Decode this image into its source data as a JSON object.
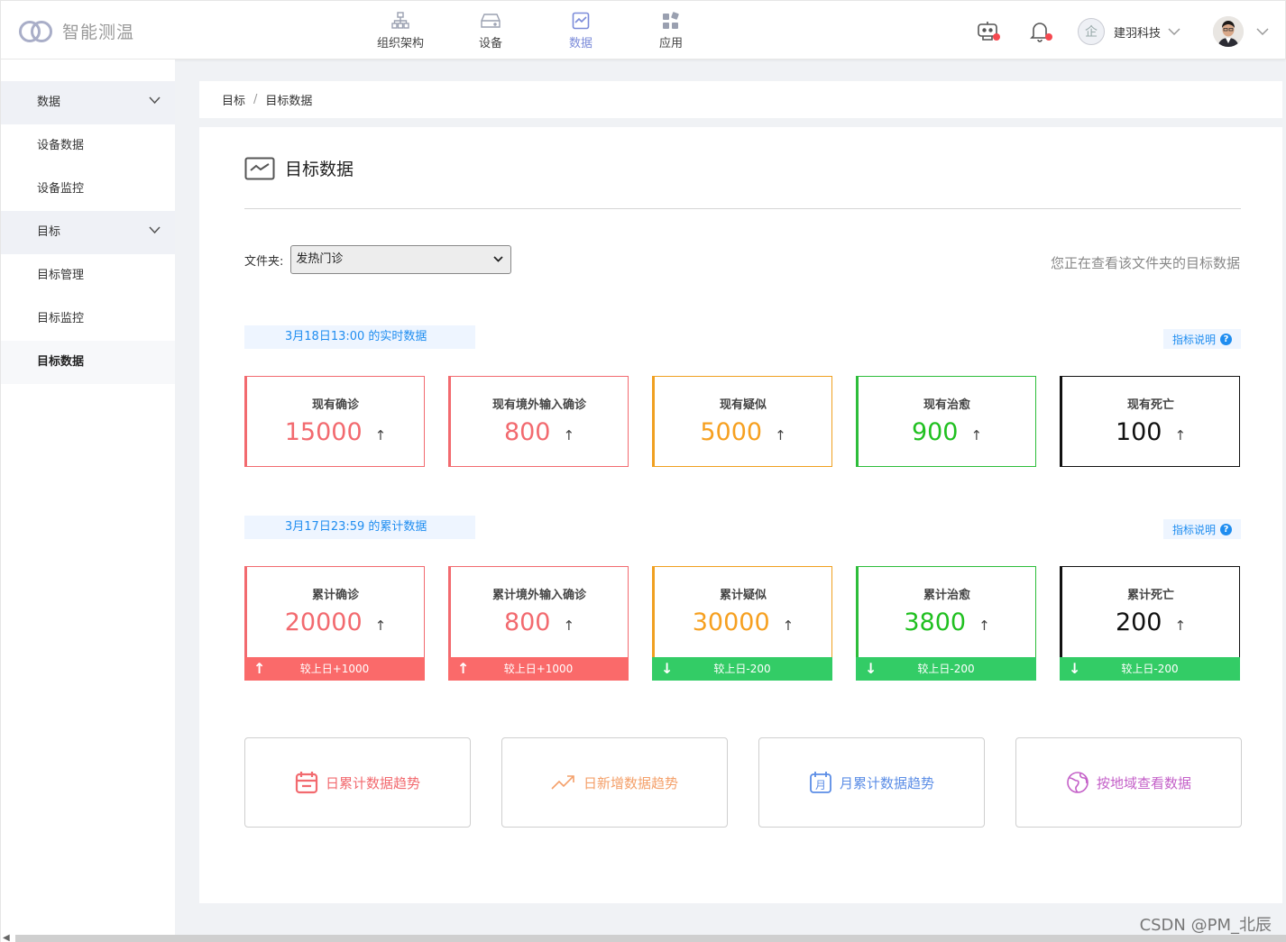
{
  "app": {
    "logo_text": "智能测温"
  },
  "topnav": [
    {
      "label": "组织架构",
      "icon": "org-chart-icon"
    },
    {
      "label": "设备",
      "icon": "device-icon"
    },
    {
      "label": "数据",
      "icon": "chart-icon"
    },
    {
      "label": "应用",
      "icon": "apps-icon"
    }
  ],
  "header": {
    "company": "建羽科技",
    "company_avatar_text": "企"
  },
  "sidebar": [
    {
      "label": "数据"
    },
    {
      "label": "设备数据"
    },
    {
      "label": "设备监控"
    },
    {
      "label": "目标"
    },
    {
      "label": "目标管理"
    },
    {
      "label": "目标监控"
    },
    {
      "label": "目标数据"
    }
  ],
  "breadcrumb": {
    "first": "目标",
    "separator": "/",
    "current": "目标数据"
  },
  "page": {
    "title": "目标数据",
    "folder_label": "文件夹:",
    "folder_value": "发热门诊",
    "folder_hint": "您正在查看该文件夹的目标数据"
  },
  "realtime": {
    "tag": "3月18日13:00  的实时数据",
    "help": "指标说明",
    "help_icon": "?",
    "cards": [
      {
        "title": "现有确诊",
        "value": "15000",
        "arrow": "↑",
        "color": "#f26a6f"
      },
      {
        "title": "现有境外输入确诊",
        "value": "800",
        "arrow": "↑",
        "color": "#f26a6f"
      },
      {
        "title": "现有疑似",
        "value": "5000",
        "arrow": "↑",
        "color": "#f6a020"
      },
      {
        "title": "现有治愈",
        "value": "900",
        "arrow": "↑",
        "color": "#20c020"
      },
      {
        "title": "现有死亡",
        "value": "100",
        "arrow": "↑",
        "color": "#111111"
      }
    ]
  },
  "cumulative": {
    "tag": "3月17日23:59  的累计数据",
    "help": "指标说明",
    "help_icon": "?",
    "cards": [
      {
        "title": "累计确诊",
        "value": "20000",
        "arrow": "↑",
        "foot": "较上日+1000",
        "foot_arrow": "↑"
      },
      {
        "title": "累计境外输入确诊",
        "value": "800",
        "arrow": "↑",
        "foot": "较上日+1000",
        "foot_arrow": "↑"
      },
      {
        "title": "累计疑似",
        "value": "30000",
        "arrow": "↑",
        "foot": "较上日-200",
        "foot_arrow": "↓"
      },
      {
        "title": "累计治愈",
        "value": "3800",
        "arrow": "↑",
        "foot": "较上日-200",
        "foot_arrow": "↓"
      },
      {
        "title": "累计死亡",
        "value": "200",
        "arrow": "↑",
        "foot": "较上日-200",
        "foot_arrow": "↓"
      }
    ]
  },
  "links": [
    {
      "label": "日累计数据趋势",
      "icon": "calendar-icon",
      "color": "#f26a6f"
    },
    {
      "label": "日新增数据趋势",
      "icon": "trend-icon",
      "color": "#f4a06a"
    },
    {
      "label": "月累计数据趋势",
      "icon": "month-calendar-icon",
      "color": "#5b8de6"
    },
    {
      "label": "按地域查看数据",
      "icon": "globe-icon",
      "color": "#c460c8"
    }
  ],
  "watermark": "CSDN @PM_北辰",
  "colors": {
    "accent": "#7b8bd9",
    "link_blue": "#1f8df0",
    "up_red": "#fa6a6a",
    "down_green": "#33cc66"
  }
}
